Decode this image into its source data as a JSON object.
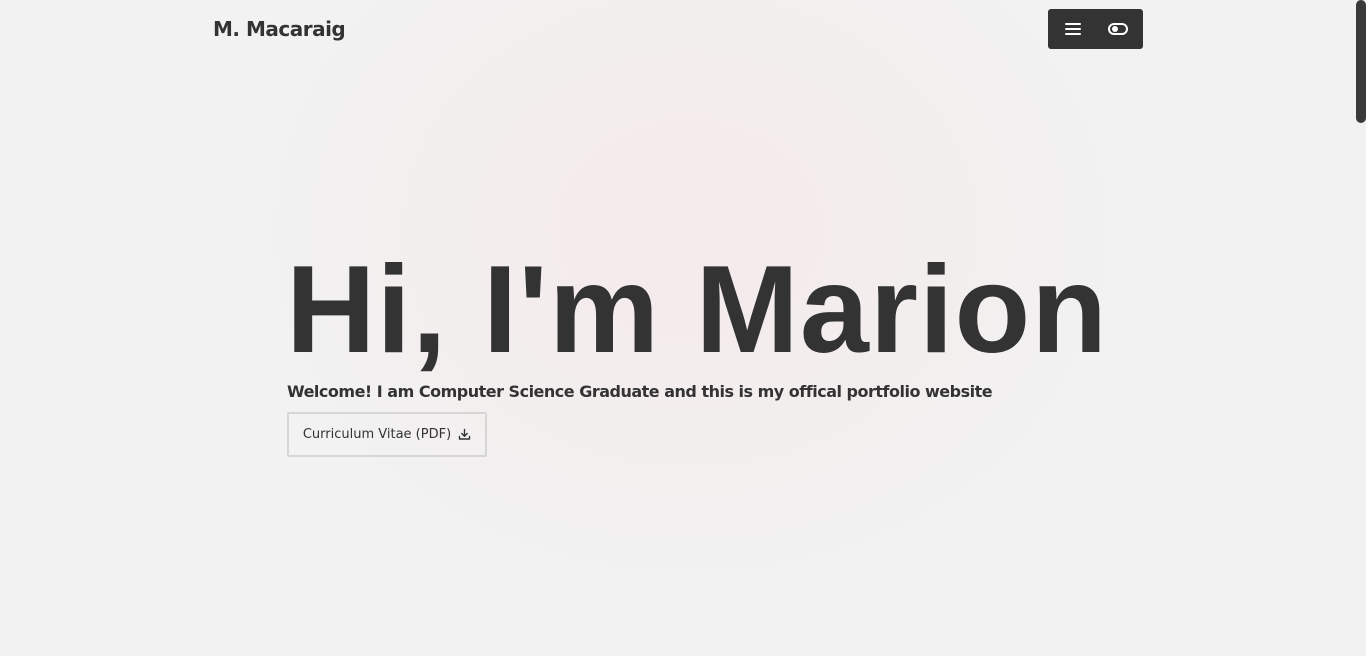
{
  "header": {
    "brand": "M. Macaraig",
    "menu_icon": "hamburger-menu-icon",
    "theme_icon": "theme-toggle-icon"
  },
  "hero": {
    "title": "Hi, I'm Marion",
    "subtitle": "Welcome! I am Computer Science Graduate and this is my offical portfolio website",
    "cv_button_label": "Curriculum Vitae (PDF)",
    "cv_button_icon": "download-icon"
  },
  "colors": {
    "text": "#333333",
    "background": "#f2f2f2",
    "nav_controls_bg": "#333333",
    "icon_fg": "#ffffff",
    "button_border": "#d6d6d6"
  }
}
